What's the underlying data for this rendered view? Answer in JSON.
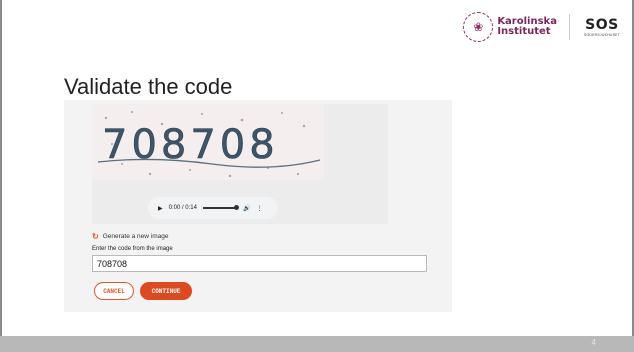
{
  "logos": {
    "karolinska_line1": "Karolinska",
    "karolinska_line2": "Institutet",
    "sos_mark": "SOS",
    "sos_sub": "SÖDERSJUKHUSET"
  },
  "slide": {
    "title": "Validate the code",
    "page_number": "4"
  },
  "captcha": {
    "image_text": "708708",
    "audio_time": "0:00 / 0:14"
  },
  "form": {
    "generate_label": "Generate a new image",
    "code_label": "Enter the code from the image",
    "code_value": "708708"
  },
  "buttons": {
    "cancel": "CANCEL",
    "continue": "CONTINUE"
  },
  "colors": {
    "accent": "#dc4a21",
    "karolinska": "#7a2560"
  }
}
